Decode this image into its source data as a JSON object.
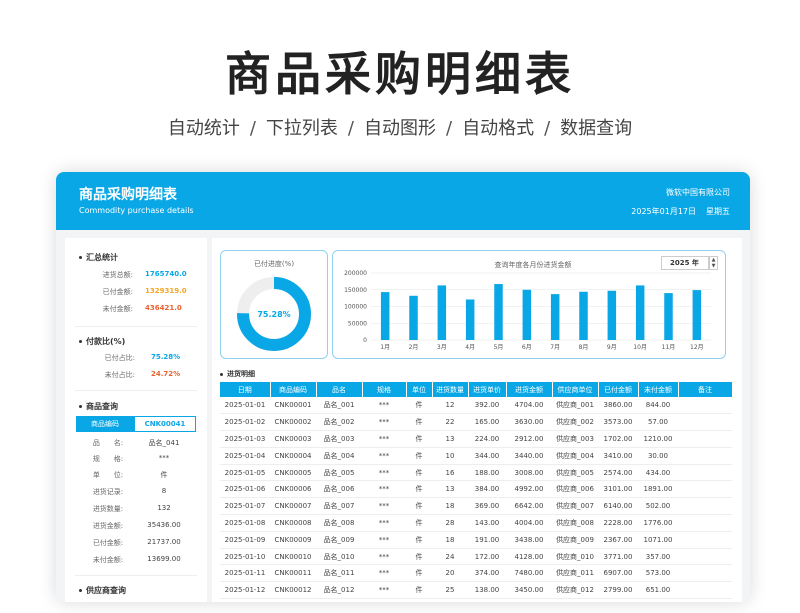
{
  "hero": {
    "title": "商品采购明细表",
    "features": [
      "自动统计",
      "下拉列表",
      "自动图形",
      "自动格式",
      "数据查询"
    ],
    "separator": "/"
  },
  "header": {
    "title": "商品采购明细表",
    "subtitle": "Commodity purchase details",
    "company": "微软中国有限公司",
    "date": "2025年01月17日",
    "weekday": "星期五",
    "color": "#0aa7e6"
  },
  "summary": {
    "title": "汇总统计",
    "items": [
      {
        "label": "进货总额:",
        "value": "1765740.0",
        "color": "#0aa7e6"
      },
      {
        "label": "已付金额:",
        "value": "1329319.0",
        "color": "#f5a623"
      },
      {
        "label": "未付金额:",
        "value": "436421.0",
        "color": "#e8622f"
      }
    ]
  },
  "ratio": {
    "title": "付款比(%)",
    "items": [
      {
        "label": "已付占比:",
        "value": "75.28%",
        "color": "#0aa7e6"
      },
      {
        "label": "未付占比:",
        "value": "24.72%",
        "color": "#e8622f"
      }
    ]
  },
  "query": {
    "title": "商品查询",
    "key_label": "商品编码",
    "key_value": "CNK00041",
    "rows": [
      {
        "label": "品　　名:",
        "value": "品名_041"
      },
      {
        "label": "规　　格:",
        "value": "***"
      },
      {
        "label": "单　　位:",
        "value": "件"
      },
      {
        "label": "进货记录:",
        "value": "8"
      },
      {
        "label": "进货数量:",
        "value": "132"
      },
      {
        "label": "进货金额:",
        "value": "35436.00"
      },
      {
        "label": "已付金额:",
        "value": "21737.00"
      },
      {
        "label": "未付金额:",
        "value": "13699.00"
      }
    ],
    "supplier_title": "供应商查询"
  },
  "gauge": {
    "title": "已付进度(%)",
    "value_label": "75.28%",
    "fraction": 0.7528,
    "color": "#0aa7e6",
    "track_color": "#eeeeee"
  },
  "chart_data": {
    "type": "bar",
    "title": "查询年度各月份进货金额",
    "year": "2025 年",
    "categories": [
      "1月",
      "2月",
      "3月",
      "4月",
      "5月",
      "6月",
      "7月",
      "8月",
      "9月",
      "10月",
      "11月",
      "12月"
    ],
    "values": [
      143000,
      132000,
      163000,
      121000,
      167000,
      150000,
      137000,
      144000,
      147000,
      163000,
      140000,
      149000
    ],
    "ylim": [
      0,
      200000
    ],
    "yticks": [
      "0",
      "50000",
      "100000",
      "150000",
      "200000"
    ],
    "grid": true,
    "color": "#0aa7e6"
  },
  "table": {
    "title": "进货明细",
    "columns": [
      "日期",
      "商品编码",
      "品名",
      "规格",
      "单位",
      "进货数量",
      "进货单价",
      "进货金额",
      "供应商单位",
      "已付金额",
      "未付金额",
      "备注"
    ],
    "rows": [
      [
        "2025-01-01",
        "CNK00001",
        "品名_001",
        "***",
        "件",
        "12",
        "392.00",
        "4704.00",
        "供应商_001",
        "3860.00",
        "844.00",
        ""
      ],
      [
        "2025-01-02",
        "CNK00002",
        "品名_002",
        "***",
        "件",
        "22",
        "165.00",
        "3630.00",
        "供应商_002",
        "3573.00",
        "57.00",
        ""
      ],
      [
        "2025-01-03",
        "CNK00003",
        "品名_003",
        "***",
        "件",
        "13",
        "224.00",
        "2912.00",
        "供应商_003",
        "1702.00",
        "1210.00",
        ""
      ],
      [
        "2025-01-04",
        "CNK00004",
        "品名_004",
        "***",
        "件",
        "10",
        "344.00",
        "3440.00",
        "供应商_004",
        "3410.00",
        "30.00",
        ""
      ],
      [
        "2025-01-05",
        "CNK00005",
        "品名_005",
        "***",
        "件",
        "16",
        "188.00",
        "3008.00",
        "供应商_005",
        "2574.00",
        "434.00",
        ""
      ],
      [
        "2025-01-06",
        "CNK00006",
        "品名_006",
        "***",
        "件",
        "13",
        "384.00",
        "4992.00",
        "供应商_006",
        "3101.00",
        "1891.00",
        ""
      ],
      [
        "2025-01-07",
        "CNK00007",
        "品名_007",
        "***",
        "件",
        "18",
        "369.00",
        "6642.00",
        "供应商_007",
        "6140.00",
        "502.00",
        ""
      ],
      [
        "2025-01-08",
        "CNK00008",
        "品名_008",
        "***",
        "件",
        "28",
        "143.00",
        "4004.00",
        "供应商_008",
        "2228.00",
        "1776.00",
        ""
      ],
      [
        "2025-01-09",
        "CNK00009",
        "品名_009",
        "***",
        "件",
        "18",
        "191.00",
        "3438.00",
        "供应商_009",
        "2367.00",
        "1071.00",
        ""
      ],
      [
        "2025-01-10",
        "CNK00010",
        "品名_010",
        "***",
        "件",
        "24",
        "172.00",
        "4128.00",
        "供应商_010",
        "3771.00",
        "357.00",
        ""
      ],
      [
        "2025-01-11",
        "CNK00011",
        "品名_011",
        "***",
        "件",
        "20",
        "374.00",
        "7480.00",
        "供应商_011",
        "6907.00",
        "573.00",
        ""
      ],
      [
        "2025-01-12",
        "CNK00012",
        "品名_012",
        "***",
        "件",
        "25",
        "138.00",
        "3450.00",
        "供应商_012",
        "2799.00",
        "651.00",
        ""
      ]
    ]
  }
}
